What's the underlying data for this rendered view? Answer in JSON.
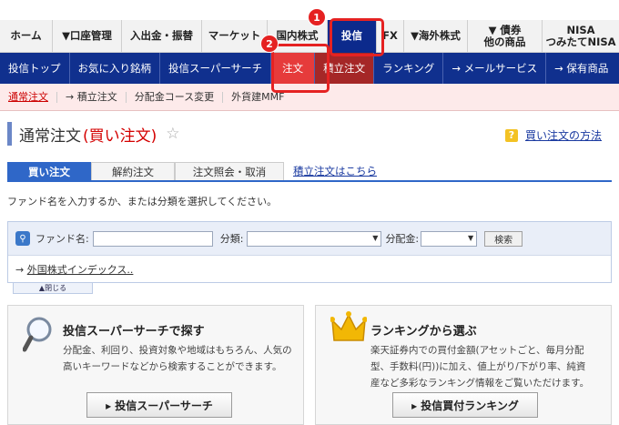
{
  "top_nav": {
    "items": [
      {
        "label": "ホーム"
      },
      {
        "label": "▼口座管理"
      },
      {
        "label": "入出金・振替"
      },
      {
        "label": "マーケット"
      },
      {
        "label": "国内株式"
      },
      {
        "label": "投信"
      },
      {
        "label": "FX"
      },
      {
        "label": "▼海外株式"
      },
      {
        "label": "▼ 債券\n他の商品"
      },
      {
        "label": "NISA\nつみたてNISA"
      }
    ],
    "active_index": 5
  },
  "sub_nav": {
    "items": [
      {
        "label": "投信トップ"
      },
      {
        "label": "お気に入り銘柄"
      },
      {
        "label": "投信スーパーサーチ"
      },
      {
        "label": "注文"
      },
      {
        "label": "積立注文"
      },
      {
        "label": "ランキング"
      },
      {
        "label": "→ メールサービス"
      },
      {
        "label": "→ 保有商品"
      }
    ],
    "active_index": 3
  },
  "tier3": {
    "items": [
      {
        "label": "通常注文"
      },
      {
        "label": "→ 積立注文"
      },
      {
        "label": "分配金コース変更"
      },
      {
        "label": "外貨建MMF"
      }
    ]
  },
  "page": {
    "title": "通常注文",
    "title_paren": "(買い注文)",
    "howto_link": "買い注文の方法"
  },
  "tabs": {
    "items": [
      {
        "label": "買い注文"
      },
      {
        "label": "解約注文"
      },
      {
        "label": "注文照会・取消"
      },
      {
        "label": "積立注文はこちら"
      }
    ]
  },
  "instructions": "ファンド名を入力するか、または分類を選択してください。",
  "search": {
    "fund_label": "ファンド名:",
    "fund_value": "",
    "category_label": "分類:",
    "category_value": "",
    "dist_label": "分配金:",
    "dist_value": "",
    "button": "検索",
    "suggestion": "外国株式インデックス..",
    "close_label": "▲閉じる"
  },
  "cards": [
    {
      "title": "投信スーパーサーチで探す",
      "desc_line1": "分配金、利回り、投資対象や地域はもちろん、人気の",
      "desc_line2": "高いキーワードなどから検索することができます。",
      "button": "▸ 投信スーパーサーチ"
    },
    {
      "title": "ランキングから選ぶ",
      "desc_line1": "楽天証券内での買付金額(アセットごと、毎月分配",
      "desc_line2": "型、手数料(円))に加え、値上がり/下がり率、純資",
      "desc_line3": "産など多彩なランキング情報をご覧いただけます。",
      "button": "▸ 投信買付ランキング"
    }
  ],
  "annotations": [
    {
      "number": "1"
    },
    {
      "number": "2"
    }
  ],
  "colors": {
    "nav_blue": "#10308e",
    "active_red": "#e63b3b",
    "annotation_red": "#e52222",
    "tab_blue": "#2f67c8"
  }
}
